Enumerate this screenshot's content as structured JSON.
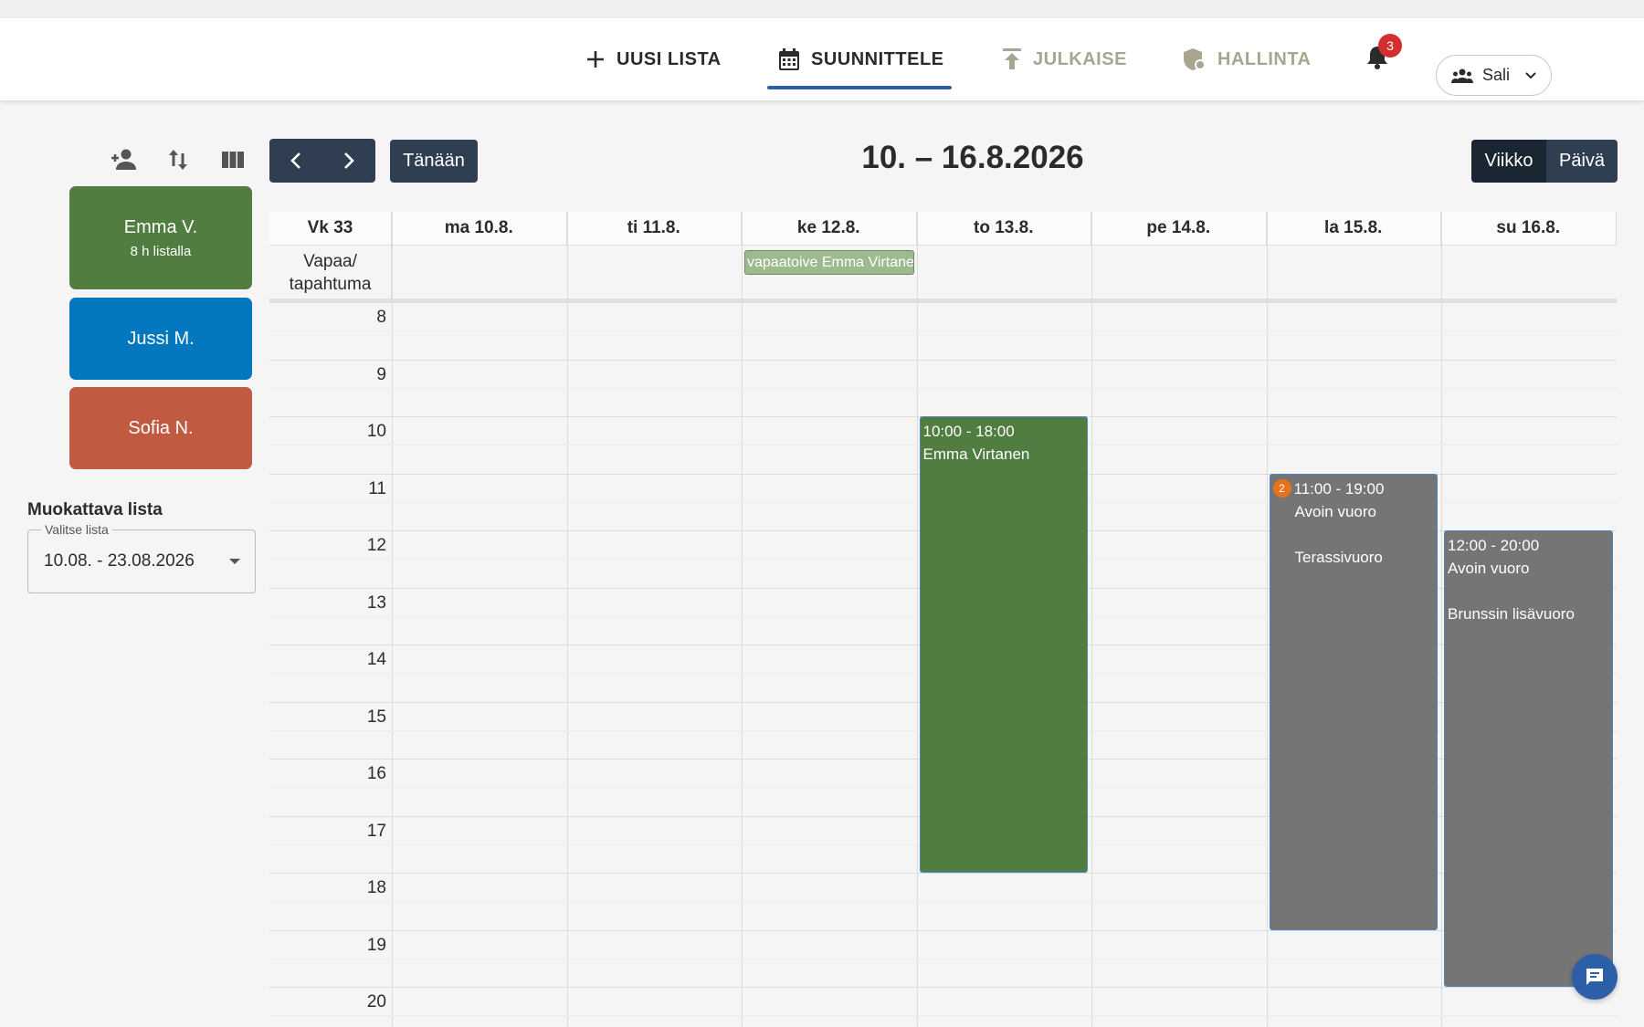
{
  "nav": {
    "new_list": "UUSI LISTA",
    "plan": "SUUNNITTELE",
    "publish": "JULKAISE",
    "admin": "HALLINTA",
    "notification_count": "3",
    "user_label": "Sali"
  },
  "sidebar": {
    "employees": [
      {
        "name": "Emma V.",
        "sub": "8 h listalla",
        "color": "#527d41"
      },
      {
        "name": "Jussi M.",
        "sub": "",
        "color": "#0277bd"
      },
      {
        "name": "Sofia N.",
        "sub": "",
        "color": "#c05a40"
      }
    ],
    "list_title": "Muokattava lista",
    "list_select_label": "Valitse lista",
    "list_select_value": "10.08. - 23.08.2026"
  },
  "toolbar": {
    "today": "Tänään",
    "range_title": "10. – 16.8.2026",
    "view_week": "Viikko",
    "view_day": "Päivä"
  },
  "calendar": {
    "week_label": "Vk 33",
    "days": [
      "ma 10.8.",
      "ti 11.8.",
      "ke 12.8.",
      "to 13.8.",
      "pe 14.8.",
      "la 15.8.",
      "su 16.8."
    ],
    "allday_label": "Vapaa/ tapahtuma",
    "allday_event": "vapaatoive Emma Virtanen",
    "hours": [
      "8",
      "9",
      "10",
      "11",
      "12",
      "13",
      "14",
      "15",
      "16",
      "17",
      "18",
      "19",
      "20"
    ],
    "events": [
      {
        "day": 3,
        "start": 10,
        "end": 18,
        "time": "10:00 - 18:00",
        "title": "Emma Virtanen",
        "note": "",
        "count": "",
        "color": "#527d41"
      },
      {
        "day": 5,
        "start": 11,
        "end": 19,
        "time": "11:00 - 19:00",
        "title": "Avoin vuoro",
        "note": "Terassivuoro",
        "count": "2",
        "color": "#757575"
      },
      {
        "day": 6,
        "start": 12,
        "end": 20,
        "time": "12:00 - 20:00",
        "title": "Avoin vuoro",
        "note": "Brunssin lisävuoro",
        "count": "",
        "color": "#757575"
      }
    ]
  }
}
